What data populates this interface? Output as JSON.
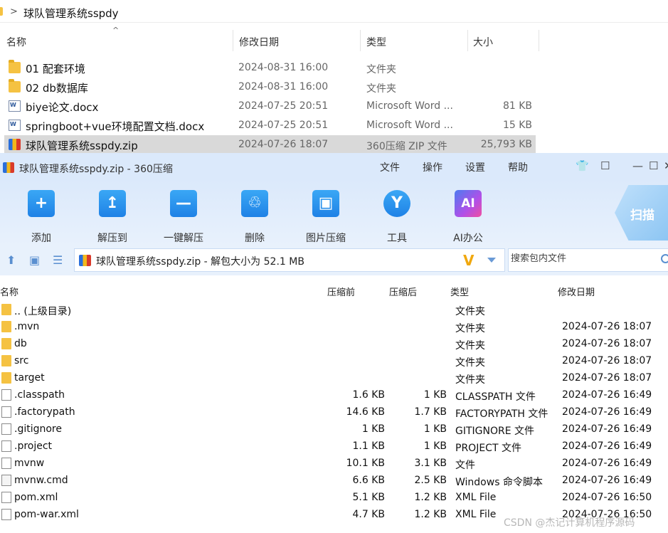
{
  "explorer": {
    "path": "球队管理系统sspdy",
    "columns": {
      "name": "名称",
      "date": "修改日期",
      "type": "类型",
      "size": "大小"
    },
    "rows": [
      {
        "name": "01 配套环境",
        "date": "2024-08-31 16:00",
        "type": "文件夹",
        "size": "",
        "icon": "folder-icon"
      },
      {
        "name": "02 db数据库",
        "date": "2024-08-31 16:00",
        "type": "文件夹",
        "size": "",
        "icon": "folder-icon"
      },
      {
        "name": "biye论文.docx",
        "date": "2024-07-25 20:51",
        "type": "Microsoft Word ...",
        "size": "81 KB",
        "icon": "word-document-icon"
      },
      {
        "name": "springboot+vue环境配置文档.docx",
        "date": "2024-07-25 20:51",
        "type": "Microsoft Word ...",
        "size": "15 KB",
        "icon": "word-document-icon"
      },
      {
        "name": "球队管理系统sspdy.zip",
        "date": "2024-07-26 18:07",
        "type": "360压缩 ZIP 文件",
        "size": "25,793 KB",
        "icon": "zip-archive-icon",
        "selected": true
      }
    ]
  },
  "zip": {
    "title": "球队管理系统sspdy.zip - 360压缩",
    "menus": [
      "文件",
      "操作",
      "设置",
      "帮助"
    ],
    "window_controls": {
      "skin": "👕",
      "feedback": "☐",
      "minimize": "—",
      "maximize": "☐",
      "close": "✕"
    },
    "tools": [
      {
        "label": "添加",
        "glyph": "+"
      },
      {
        "label": "解压到",
        "glyph": "↥"
      },
      {
        "label": "一键解压",
        "glyph": "—"
      },
      {
        "label": "删除",
        "glyph": "♲"
      },
      {
        "label": "图片压缩",
        "glyph": "▣"
      },
      {
        "label": "工具",
        "glyph": "Y"
      },
      {
        "label": "AI办公",
        "glyph": "AI"
      }
    ],
    "scan_label": "扫描",
    "path_text": "球队管理系统sspdy.zip - 解包大小为 52.1 MB",
    "v_mark": "V",
    "search_placeholder": "搜索包内文件",
    "list_columns": {
      "name": "名称",
      "compressed": "压缩前",
      "after": "压缩后",
      "type": "类型",
      "date": "修改日期"
    },
    "list_rows": [
      {
        "name": ".. (上级目录)",
        "before": "",
        "after": "",
        "type": "文件夹",
        "date": "",
        "icon": "folder"
      },
      {
        "name": ".mvn",
        "before": "",
        "after": "",
        "type": "文件夹",
        "date": "2024-07-26 18:07",
        "icon": "folder"
      },
      {
        "name": "db",
        "before": "",
        "after": "",
        "type": "文件夹",
        "date": "2024-07-26 18:07",
        "icon": "folder"
      },
      {
        "name": "src",
        "before": "",
        "after": "",
        "type": "文件夹",
        "date": "2024-07-26 18:07",
        "icon": "folder"
      },
      {
        "name": "target",
        "before": "",
        "after": "",
        "type": "文件夹",
        "date": "2024-07-26 18:07",
        "icon": "folder"
      },
      {
        "name": ".classpath",
        "before": "1.6 KB",
        "after": "1 KB",
        "type": "CLASSPATH 文件",
        "date": "2024-07-26 16:49",
        "icon": "file"
      },
      {
        "name": ".factorypath",
        "before": "14.6 KB",
        "after": "1.7 KB",
        "type": "FACTORYPATH 文件",
        "date": "2024-07-26 16:49",
        "icon": "file"
      },
      {
        "name": ".gitignore",
        "before": "1 KB",
        "after": "1 KB",
        "type": "GITIGNORE 文件",
        "date": "2024-07-26 16:49",
        "icon": "file"
      },
      {
        "name": ".project",
        "before": "1.1 KB",
        "after": "1 KB",
        "type": "PROJECT 文件",
        "date": "2024-07-26 16:49",
        "icon": "file"
      },
      {
        "name": "mvnw",
        "before": "10.1 KB",
        "after": "3.1 KB",
        "type": "文件",
        "date": "2024-07-26 16:49",
        "icon": "file"
      },
      {
        "name": "mvnw.cmd",
        "before": "6.6 KB",
        "after": "2.5 KB",
        "type": "Windows 命令脚本",
        "date": "2024-07-26 16:49",
        "icon": "cmd"
      },
      {
        "name": "pom.xml",
        "before": "5.1 KB",
        "after": "1.2 KB",
        "type": "XML File",
        "date": "2024-07-26 16:50",
        "icon": "file"
      },
      {
        "name": "pom-war.xml",
        "before": "4.7 KB",
        "after": "1.2 KB",
        "type": "XML File",
        "date": "2024-07-26 16:50",
        "icon": "file"
      }
    ]
  },
  "watermark": "CSDN @杰记计算机程序源码"
}
